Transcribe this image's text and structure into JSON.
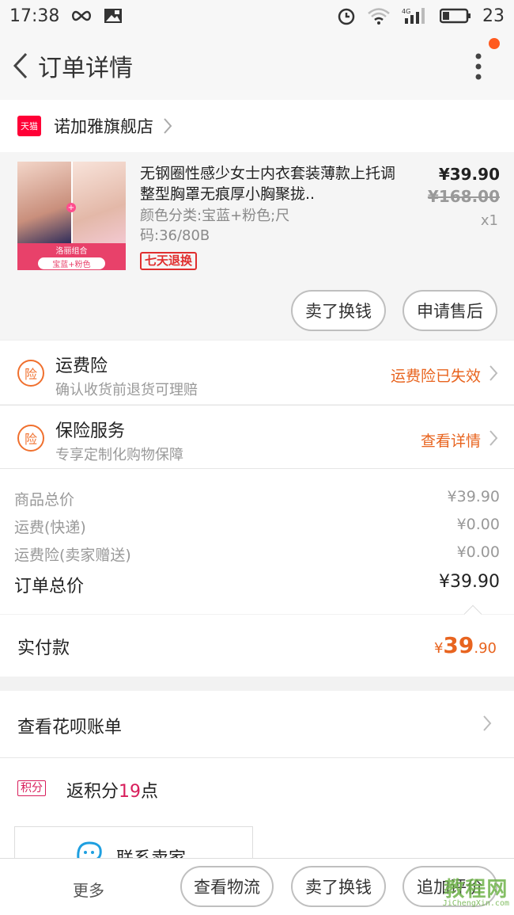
{
  "status_bar": {
    "time": "17:38",
    "battery": "23"
  },
  "nav": {
    "title": "订单详情"
  },
  "store": {
    "badge": "天猫",
    "name": "诺加雅旗舰店"
  },
  "product": {
    "title": "无钢圈性感少女士内衣套装薄款上托调整型胸罩无痕厚小胸聚拢..",
    "spec": "颜色分类:宝蓝+粉色;尺码:36/80B",
    "return_badge": "七天退换",
    "price": "¥39.90",
    "original_price": "¥168.00",
    "quantity": "x1",
    "image_caption": "洛丽组合",
    "image_color": "宝蓝+粉色",
    "image_plus": "+",
    "sell_button": "卖了换钱",
    "after_sale_button": "申请售后"
  },
  "insurance": [
    {
      "icon": "险",
      "title": "运费险",
      "subtitle": "确认收货前退货可理赔",
      "status": "运费险已失效"
    },
    {
      "icon": "险",
      "title": "保险服务",
      "subtitle": "专享定制化购物保障",
      "status": "查看详情"
    }
  ],
  "summary": {
    "rows": [
      {
        "label": "商品总价",
        "value": "¥39.90"
      },
      {
        "label": "运费(快递)",
        "value": "¥0.00"
      },
      {
        "label": "运费险(卖家赠送)",
        "value": "¥0.00"
      }
    ],
    "total_label": "订单总价",
    "total_value": "¥39.90"
  },
  "payment": {
    "label": "实付款",
    "currency": "¥",
    "integer": "39",
    "decimal": ".90"
  },
  "huabei": {
    "label": "查看花呗账单"
  },
  "points": {
    "badge": "积分",
    "prefix": "返积分",
    "count": "19",
    "suffix": "点"
  },
  "contact": {
    "label": "联系卖家"
  },
  "bottom_bar": {
    "more": "更多",
    "logistics": "查看物流",
    "sell": "卖了换钱",
    "review": "追加评价"
  },
  "watermark": {
    "main": "教程网",
    "sub": "JiChengXin.com"
  },
  "colors": {
    "accent_orange": "#e8641f",
    "tmall_red": "#ff0036",
    "points_red": "#d81e5b"
  }
}
